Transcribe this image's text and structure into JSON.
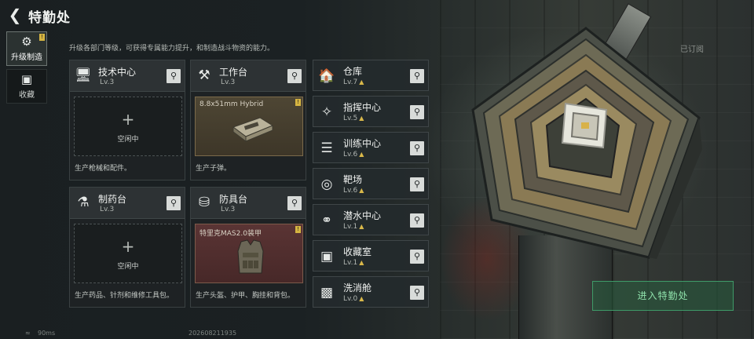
{
  "header": {
    "title": "特勤处",
    "subscribed_label": "已订阅"
  },
  "sidebar": {
    "items": [
      {
        "label": "升级制造",
        "icon": "upgrade-craft-icon",
        "active": true,
        "badge": "!"
      },
      {
        "label": "收藏",
        "icon": "collection-icon",
        "active": false
      }
    ]
  },
  "description": "升级各部门等级，可获得专属能力提升，和制造战斗物资的能力。",
  "workbenches": [
    {
      "name": "技术中心",
      "level": "Lv.3",
      "icon": "tech-center-icon",
      "slot": {
        "state": "empty",
        "idle_label": "空闲中",
        "plus": "+"
      },
      "description": "生产枪械和配件。"
    },
    {
      "name": "工作台",
      "level": "Lv.3",
      "icon": "workbench-icon",
      "slot": {
        "state": "item",
        "item_name": "8.8x51mm Hybrid",
        "badge": "!"
      },
      "description": "生产子弹。"
    },
    {
      "name": "制药台",
      "level": "Lv.3",
      "icon": "pharmacy-icon",
      "slot": {
        "state": "empty",
        "idle_label": "空闲中",
        "plus": "+"
      },
      "description": "生产药品、针剂和维修工具包。"
    },
    {
      "name": "防具台",
      "level": "Lv.3",
      "icon": "armor-bench-icon",
      "slot": {
        "state": "item",
        "item_name": "特里克MAS2.0装甲",
        "badge": "!"
      },
      "description": "生产头盔、护甲、胸挂和背包。"
    }
  ],
  "facilities": [
    {
      "name": "仓库",
      "level": "Lv.7",
      "icon": "warehouse-icon",
      "upgradable": true
    },
    {
      "name": "指挥中心",
      "level": "Lv.5",
      "icon": "command-center-icon",
      "upgradable": true
    },
    {
      "name": "训练中心",
      "level": "Lv.6",
      "icon": "training-center-icon",
      "upgradable": true
    },
    {
      "name": "靶场",
      "level": "Lv.6",
      "icon": "shooting-range-icon",
      "upgradable": true
    },
    {
      "name": "潜水中心",
      "level": "Lv.1",
      "icon": "diving-center-icon",
      "upgradable": true
    },
    {
      "name": "收藏室",
      "level": "Lv.1",
      "icon": "collection-room-icon",
      "upgradable": true
    },
    {
      "name": "洗消舱",
      "level": "Lv.0",
      "icon": "decon-chamber-icon",
      "upgradable": true
    }
  ],
  "actions": {
    "enter_label": "进入特勤处",
    "back_icon": "back-arrow-icon",
    "search_icon": "search-icon"
  },
  "status": {
    "ping": "90ms",
    "build": "202608211935"
  },
  "colors": {
    "accent_green": "#3e9a68",
    "badge_gold": "#d5b441",
    "upgrade_arrow": "#d9b84a"
  }
}
